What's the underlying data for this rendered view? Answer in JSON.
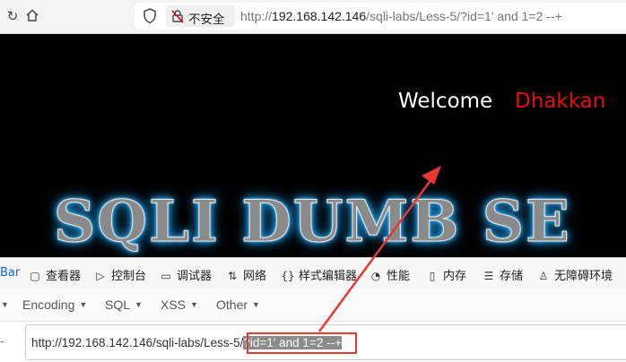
{
  "browser": {
    "security_label": "不安全",
    "url_prefix": "http://",
    "url_host": "192.168.142.146",
    "url_path": "/sqli-labs/Less-5/?id=1' and 1=2 --+"
  },
  "page": {
    "welcome_label": "Welcome",
    "welcome_name": "Dhakkan",
    "banner_text": "SQLI DUMB SE"
  },
  "devtools": {
    "tabs": [
      {
        "label": "Bar",
        "icon": "hackbar-icon"
      },
      {
        "label": "查看器",
        "icon": "inspector-icon"
      },
      {
        "label": "控制台",
        "icon": "console-icon"
      },
      {
        "label": "调试器",
        "icon": "debugger-icon"
      },
      {
        "label": "网络",
        "icon": "network-icon"
      },
      {
        "label": "样式编辑器",
        "icon": "style-editor-icon"
      },
      {
        "label": "性能",
        "icon": "performance-icon"
      },
      {
        "label": "内存",
        "icon": "memory-icon"
      },
      {
        "label": "存储",
        "icon": "storage-icon"
      },
      {
        "label": "无障碍环境",
        "icon": "accessibility-icon"
      }
    ]
  },
  "hackbar": {
    "menu": [
      "Encoding",
      "SQL",
      "XSS",
      "Other"
    ],
    "dash": "-",
    "url_plain": "http://192.168.142.146/sqli-labs/Less-5/",
    "url_selected": "?id=1' and 1=2 --+"
  },
  "colors": {
    "annotation": "#e53935",
    "welcome_name": "#e01010",
    "active_tab": "#0a6ad6"
  }
}
